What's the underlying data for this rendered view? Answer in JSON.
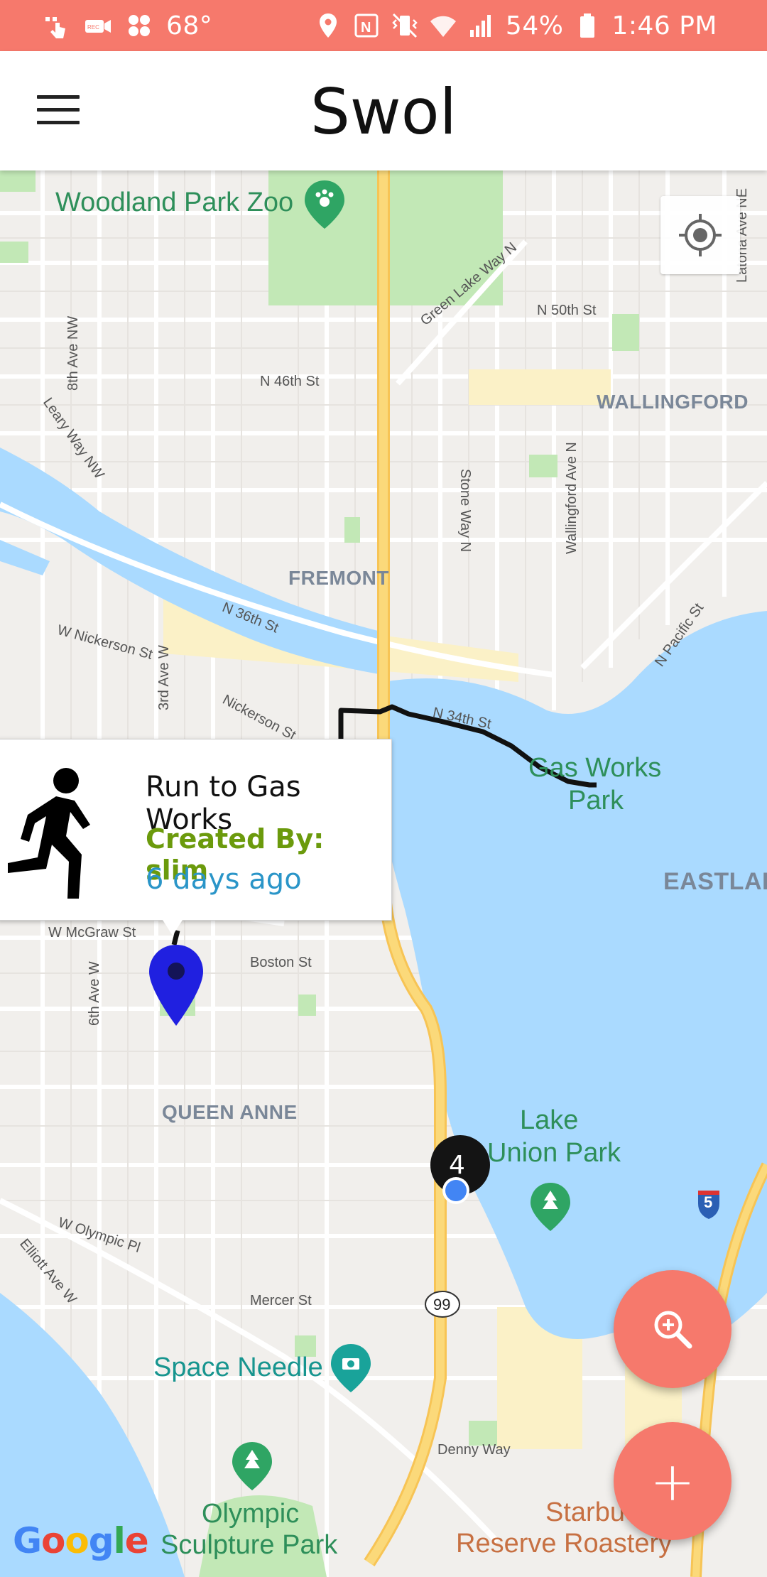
{
  "status_bar": {
    "temperature": "68°",
    "battery": "54%",
    "time": "1:46 PM",
    "left_icons": [
      "touch-icon",
      "rec-icon",
      "game-icon"
    ],
    "right_icons": [
      "location-icon",
      "nfc-icon",
      "vibrate-icon",
      "wifi-icon",
      "signal-icon",
      "battery-icon"
    ]
  },
  "app_bar": {
    "title": "Swol",
    "menu_icon": "menu-icon"
  },
  "map": {
    "labels": {
      "woodland_park_zoo": "Woodland Park Zoo",
      "n_50th": "N 50th St",
      "green_lake_way": "Green Lake Way N",
      "latona": "Latona Ave NE",
      "ave_8th": "8th Ave NW",
      "n_46th": "N 46th St",
      "wallingford": "WALLINGFORD",
      "leary": "Leary Way NW",
      "stone_way": "Stone Way N",
      "wallingford_ave": "Wallingford Ave N",
      "fremont": "FREMONT",
      "n_36th": "N 36th St",
      "nickerson_w": "W Nickerson St",
      "n_pacific": "N Pacific St",
      "ave_3rd": "3rd Ave W",
      "nickerson": "Nickerson St",
      "n_34th": "N 34th St",
      "gas_works_1": "Gas Works",
      "gas_works_2": "Park",
      "eastlake": "EASTLAKE",
      "w_mcgraw": "W McGraw St",
      "boston": "Boston St",
      "ave_6th": "6th Ave W",
      "queen_anne": "QUEEN ANNE",
      "lake_union_1": "Lake",
      "lake_union_2": "Union Park",
      "w_olympic": "W Olympic Pl",
      "elliott": "Elliott Ave W",
      "mercer": "Mercer St",
      "hwy_99": "99",
      "i5": "5",
      "space_needle": "Space Needle",
      "denny": "Denny Way",
      "olympic_1": "Olympic",
      "olympic_2": "Sculpture Park",
      "starbucks_1": "Starbucks",
      "starbucks_2": "Reserve Roastery"
    },
    "cluster_count": "4",
    "attribution": "Google"
  },
  "info_window": {
    "title": "Run to Gas Works",
    "created_by": "Created By: slim",
    "time_ago": "6 days ago",
    "icon": "running-person-icon"
  },
  "fabs": {
    "search_icon": "zoom-in-icon",
    "add_label": "+"
  },
  "colors": {
    "accent": "#f6796c",
    "water": "#aadaff",
    "park": "#c2e8b6",
    "highway": "#fbd97a",
    "route": "#111111",
    "marker": "#2020e0",
    "created_by": "#6b9a0c",
    "time": "#2a95c8"
  }
}
